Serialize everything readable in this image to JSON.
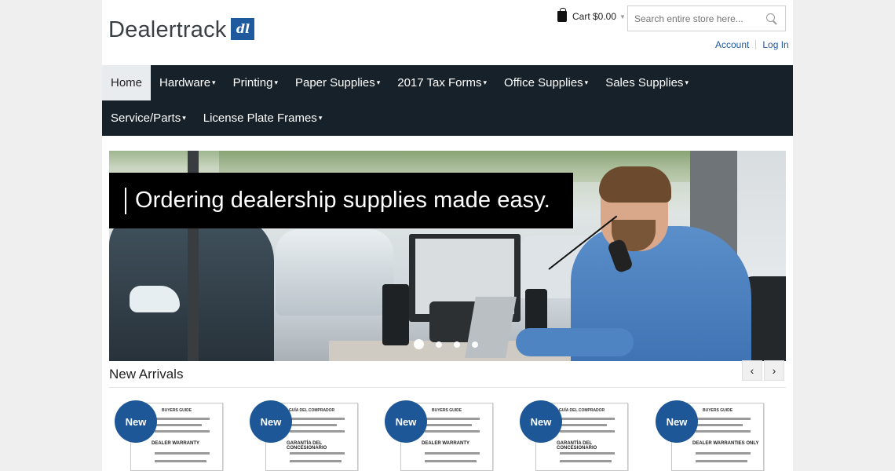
{
  "header": {
    "logo_text": "Dealertrack",
    "logo_mark": "dl",
    "cart_label": "Cart $0.00",
    "search_placeholder": "Search entire store here...",
    "account_link": "Account",
    "login_link": "Log In"
  },
  "nav": {
    "items": [
      {
        "label": "Home"
      },
      {
        "label": "Hardware"
      },
      {
        "label": "Printing"
      },
      {
        "label": "Paper Supplies"
      },
      {
        "label": "2017 Tax Forms"
      },
      {
        "label": "Office Supplies"
      },
      {
        "label": "Sales Supplies"
      },
      {
        "label": "Service/Parts"
      },
      {
        "label": "License Plate Frames"
      }
    ]
  },
  "hero": {
    "banner_text": "Ordering dealership supplies made easy.",
    "slide_count": 4,
    "active_slide": 1
  },
  "new_arrivals": {
    "title": "New Arrivals",
    "prev_icon": "‹",
    "next_icon": "›",
    "products": [
      {
        "badge": "New",
        "doc_title": "BUYERS GUIDE",
        "doc_heading": "DEALER WARRANTY"
      },
      {
        "badge": "New",
        "doc_title": "GUÍA DEL COMPRADOR",
        "doc_heading": "GARANTÍA DEL CONCESIONARIO"
      },
      {
        "badge": "New",
        "doc_title": "BUYERS GUIDE",
        "doc_heading": "DEALER WARRANTY"
      },
      {
        "badge": "New",
        "doc_title": "GUÍA DEL COMPRADOR",
        "doc_heading": "GARANTÍA DEL CONCESIONARIO"
      },
      {
        "badge": "New",
        "doc_title": "BUYERS GUIDE",
        "doc_heading": "DEALER WARRANTIES ONLY"
      }
    ]
  },
  "colors": {
    "nav_bg": "#162129",
    "brand_blue": "#1f5a9e",
    "badge_blue": "#1d5798"
  }
}
